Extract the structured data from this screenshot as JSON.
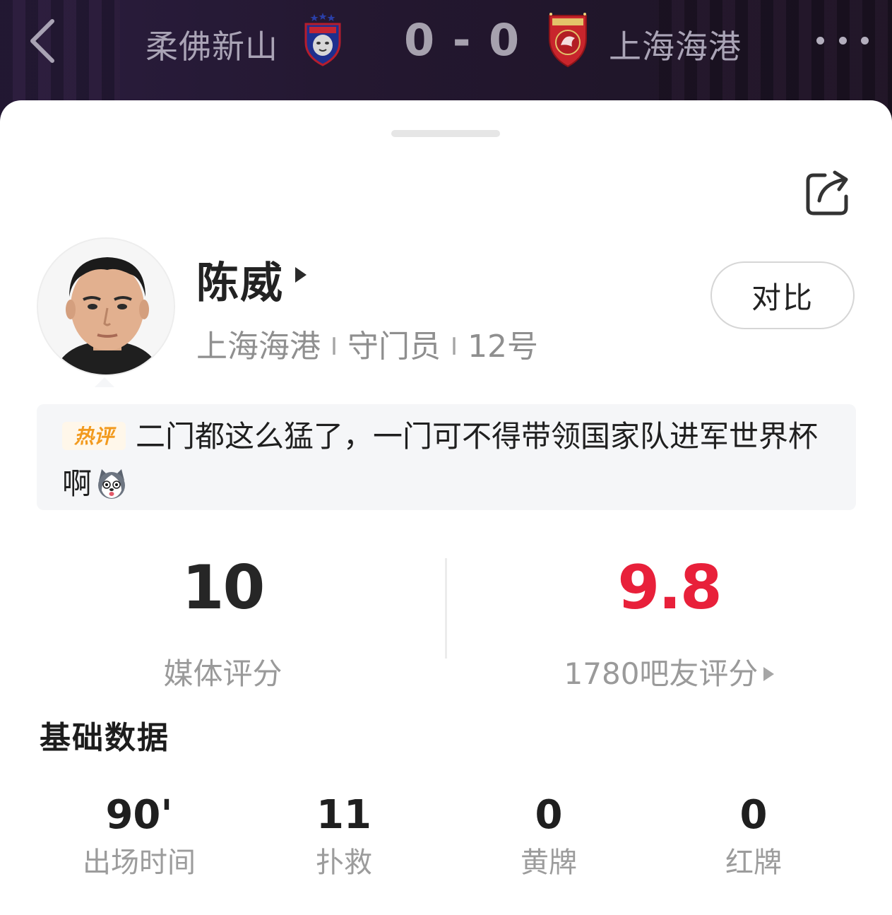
{
  "header": {
    "home_team": "柔佛新山",
    "score": "0 - 0",
    "away_team": "上海海港"
  },
  "player": {
    "name": "陈威",
    "team": "上海海港",
    "position": "守门员",
    "number": "12号",
    "compare_label": "对比"
  },
  "hot_comment": {
    "tag": "热评",
    "text": "二门都这么猛了，一门可不得带领国家队进军世界杯啊"
  },
  "ratings": {
    "media_score": "10",
    "media_label": "媒体评分",
    "fan_score": "9.8",
    "fan_label": "1780吧友评分"
  },
  "basic_stats": {
    "title": "基础数据",
    "items": [
      {
        "value": "90'",
        "label": "出场时间"
      },
      {
        "value": "11",
        "label": "扑救"
      },
      {
        "value": "0",
        "label": "黄牌"
      },
      {
        "value": "0",
        "label": "红牌"
      }
    ]
  },
  "colors": {
    "fan_score": "#e8203a",
    "header_bg": "#2a1d3e"
  }
}
